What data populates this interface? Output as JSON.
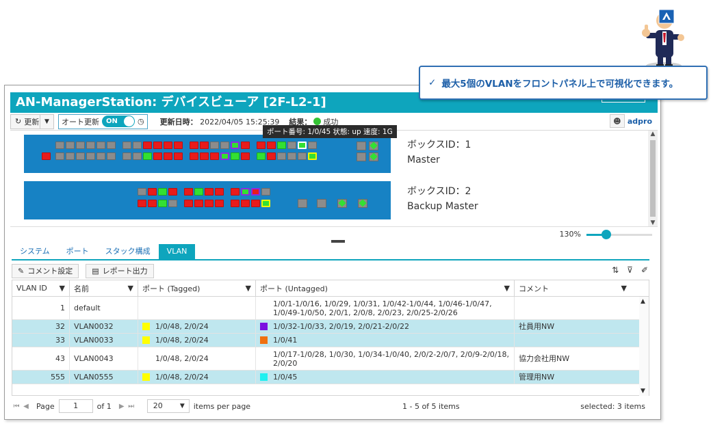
{
  "callout": {
    "check": "✓",
    "text": "最大5個のVLANをフロントパネル上で可視化できます。"
  },
  "window": {
    "title": "AN-ManagerStation: デバイスビューア [2F-L2-1]",
    "toolbar": {
      "refresh_label": "更新",
      "auto_refresh_label": "オート更新",
      "toggle_state": "ON",
      "updated_label": "更新日時：",
      "updated_value": "2022/04/05 15:25:39",
      "result_label": "結果：",
      "result_value": "成功",
      "user": "adpro"
    },
    "tooltip": "ポート番号: 1/0/45 状態: up 速度: 1G",
    "boxes": [
      {
        "id_line": "ボックスID：1",
        "role": "Master"
      },
      {
        "id_line": "ボックスID：2",
        "role": "Backup Master"
      }
    ],
    "zoom": {
      "label": "130%",
      "level": 0.3
    }
  },
  "tabs": [
    {
      "label": "システム",
      "active": false
    },
    {
      "label": "ポート",
      "active": false
    },
    {
      "label": "スタック構成",
      "active": false
    },
    {
      "label": "VLAN",
      "active": true
    }
  ],
  "grid_toolbar": {
    "comment_btn": "コメント設定",
    "report_btn": "レポート出力"
  },
  "grid": {
    "columns": [
      "VLAN ID",
      "名前",
      "ポート (Tagged)",
      "ポート (Untagged)",
      "コメント"
    ],
    "rows": [
      {
        "id": "1",
        "name": "default",
        "tagged": "",
        "tagged_color": "",
        "untagged": "1/0/1-1/0/16, 1/0/29, 1/0/31, 1/0/42-1/0/44, 1/0/46-1/0/47, 1/0/49-1/0/50, 2/0/1, 2/0/8, 2/0/23, 2/0/25-2/0/26",
        "untagged_color": "",
        "comment": "",
        "selected": false
      },
      {
        "id": "32",
        "name": "VLAN0032",
        "tagged": "1/0/48, 2/0/24",
        "tagged_color": "#ffff00",
        "untagged": "1/0/32-1/0/33, 2/0/19, 2/0/21-2/0/22",
        "untagged_color": "#7b10e0",
        "comment": "社員用NW",
        "selected": true
      },
      {
        "id": "33",
        "name": "VLAN0033",
        "tagged": "1/0/48, 2/0/24",
        "tagged_color": "#ffff00",
        "untagged": "1/0/41",
        "untagged_color": "#f07010",
        "comment": "",
        "selected": true
      },
      {
        "id": "43",
        "name": "VLAN0043",
        "tagged": "1/0/48, 2/0/24",
        "tagged_color": "",
        "untagged": "1/0/17-1/0/28, 1/0/30, 1/0/34-1/0/40, 2/0/2-2/0/7, 2/0/9-2/0/18, 2/0/20",
        "untagged_color": "",
        "comment": "協力会社用NW",
        "selected": false
      },
      {
        "id": "555",
        "name": "VLAN0555",
        "tagged": "1/0/48, 2/0/24",
        "tagged_color": "#ffff00",
        "untagged": "1/0/45",
        "untagged_color": "#20f0f0",
        "comment": "管理用NW",
        "selected": true
      }
    ]
  },
  "pager": {
    "page_label": "Page",
    "page_value": "1",
    "of_label": "of 1",
    "per_page_value": "20",
    "per_page_label": "items per page",
    "range_info": "1 - 5 of 5 items",
    "selected_info": "selected: 3 items"
  },
  "colors": {
    "accent": "#0ea5bd",
    "panel": "#1782c4",
    "selected_row": "#bfe7ef"
  }
}
